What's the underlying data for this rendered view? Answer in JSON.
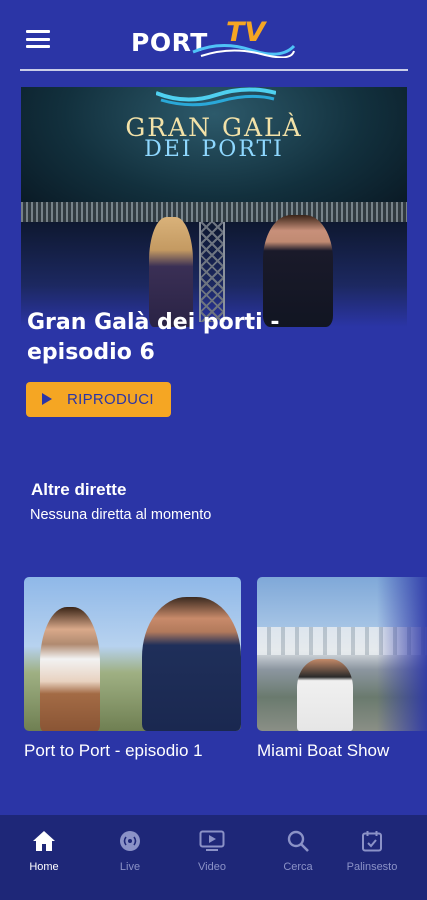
{
  "header": {
    "logo_text_port": "PORT",
    "logo_text_tv": "TV",
    "menu_icon": "hamburger-menu-icon"
  },
  "hero": {
    "banner_line1": "GRAN GALÀ",
    "banner_line2": "DEI PORTI",
    "title": "Gran Galà dei porti - episodio 6",
    "play_label": "RIPRODUCI",
    "play_icon": "play-icon"
  },
  "live_section": {
    "title": "Altre dirette",
    "subtitle": "Nessuna diretta al momento"
  },
  "cards": [
    {
      "title": "Port to Port - episodio 1"
    },
    {
      "title": "Miami Boat Show"
    }
  ],
  "bottom_nav": [
    {
      "label": "Home",
      "icon": "home-icon",
      "active": true
    },
    {
      "label": "Live",
      "icon": "live-icon",
      "active": false
    },
    {
      "label": "Video",
      "icon": "video-icon",
      "active": false
    },
    {
      "label": "Cerca",
      "icon": "search-icon",
      "active": false
    },
    {
      "label": "Palinsesto",
      "icon": "calendar-icon",
      "active": false
    }
  ],
  "colors": {
    "background": "#2b35a6",
    "accent": "#f5a623",
    "nav_background": "#1e2778",
    "nav_inactive": "#8b92c7"
  }
}
